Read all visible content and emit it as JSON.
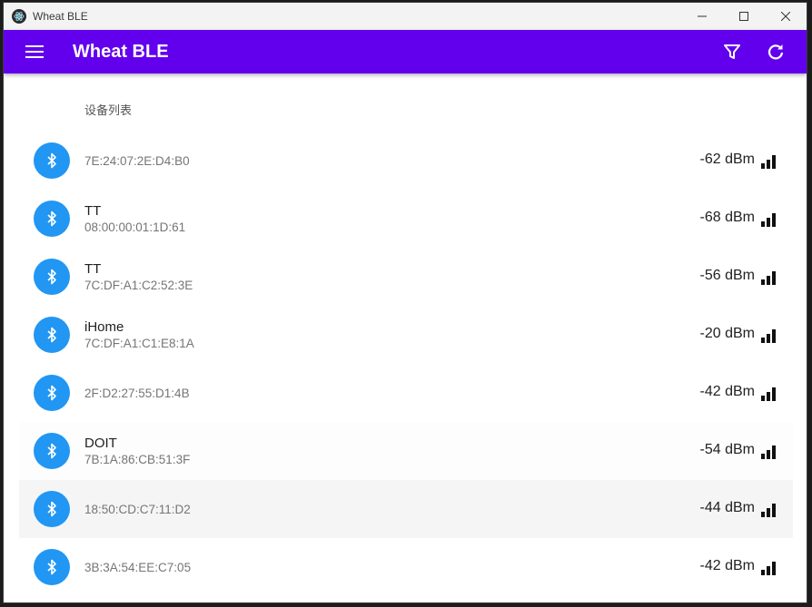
{
  "window": {
    "title": "Wheat BLE"
  },
  "appbar": {
    "title": "Wheat BLE",
    "color": "#6200ee",
    "icons": [
      "menu-icon",
      "filter-icon",
      "refresh-icon"
    ]
  },
  "list": {
    "subheader": "设备列表",
    "devices": [
      {
        "name": "",
        "address": "7E:24:07:2E:D4:B0",
        "rssi": "-62 dBm"
      },
      {
        "name": "TT",
        "address": "08:00:00:01:1D:61",
        "rssi": "-68 dBm"
      },
      {
        "name": "TT",
        "address": "7C:DF:A1:C2:52:3E",
        "rssi": "-56 dBm"
      },
      {
        "name": "iHome",
        "address": "7C:DF:A1:C1:E8:1A",
        "rssi": "-20 dBm"
      },
      {
        "name": "",
        "address": "2F:D2:27:55:D1:4B",
        "rssi": "-42 dBm"
      },
      {
        "name": "DOIT",
        "address": "7B:1A:86:CB:51:3F",
        "rssi": "-54 dBm"
      },
      {
        "name": "",
        "address": "18:50:CD:C7:11:D2",
        "rssi": "-44 dBm"
      },
      {
        "name": "",
        "address": "3B:3A:54:EE:C7:05",
        "rssi": "-42 dBm"
      }
    ]
  },
  "colors": {
    "accent": "#6200ee",
    "bluetooth": "#2196f3"
  }
}
